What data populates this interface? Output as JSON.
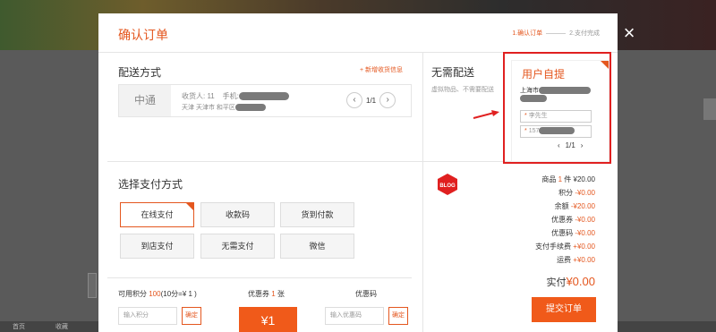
{
  "modal": {
    "title": "确认订单",
    "steps": [
      "1.确认订单",
      "2.支付完成"
    ],
    "close": "×"
  },
  "delivery": {
    "title": "配送方式",
    "add_address": "+ 新增收货信息",
    "carrier": "中通",
    "recipient_prefix": "收货人: 11",
    "phone_prefix": "手机:",
    "address_prefix": "天津 天津市 和平区",
    "pager": "1/1",
    "prev": "‹",
    "next": "›"
  },
  "no_delivery": {
    "title": "无需配送",
    "note": "虚拟物品、不需要配送"
  },
  "pickup": {
    "title": "用户自提",
    "city_prefix": "上海市",
    "name_placeholder": "李先生",
    "phone_prefix": "157",
    "pager": "1/1",
    "prev": "‹",
    "next": "›"
  },
  "payment": {
    "title": "选择支付方式",
    "options": [
      "在线支付",
      "收款码",
      "货到付款",
      "到店支付",
      "无需支付",
      "微信"
    ],
    "selected_index": 0
  },
  "points": {
    "label": "可用积分",
    "value": "100",
    "rule": "(10分=¥ 1 )",
    "placeholder": "输入积分",
    "confirm": "确定"
  },
  "coupon": {
    "label_prefix": "优惠券",
    "count": "1",
    "label_suffix": "张",
    "tile_value": "¥1"
  },
  "promo_code": {
    "label": "优惠码",
    "placeholder": "输入优惠码",
    "confirm": "确定"
  },
  "summary": {
    "badge_text": "BLOG",
    "goods_label": "商品",
    "goods_count": "1",
    "goods_unit": "件",
    "goods_value": "¥20.00",
    "rows": [
      {
        "label": "积分",
        "value": "-¥0.00"
      },
      {
        "label": "余额",
        "value": "-¥20.00"
      },
      {
        "label": "优惠券",
        "value": "-¥0.00"
      },
      {
        "label": "优惠码",
        "value": "-¥0.00"
      },
      {
        "label": "支付手续费",
        "value": "+¥0.00"
      },
      {
        "label": "运费",
        "value": "+¥0.00"
      }
    ],
    "actual_label": "实付",
    "actual_value": "¥0.00",
    "submit": "提交订单"
  },
  "background": {
    "footer_left": "首页",
    "footer_mid": "收藏"
  },
  "colors": {
    "accent": "#e4571f",
    "highlight_frame": "#e02020"
  }
}
